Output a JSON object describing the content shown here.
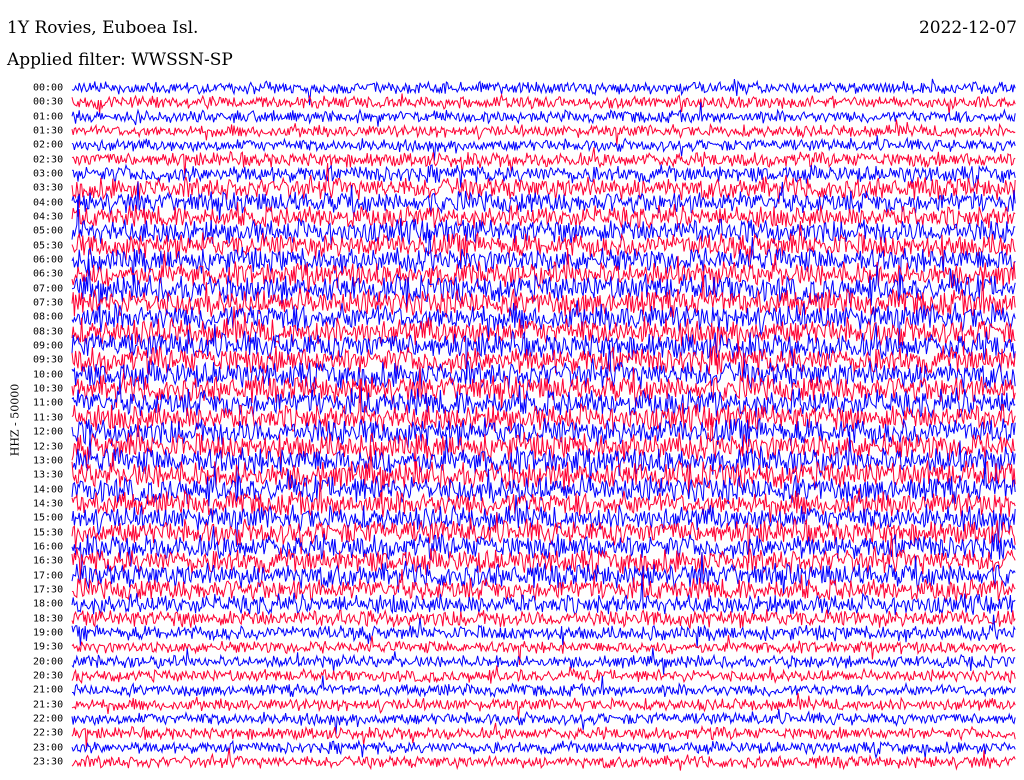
{
  "chart_data": {
    "type": "line",
    "title": "1Y Rovies, Euboea Isl.",
    "date": "2022-12-07",
    "filter_label": "Applied filter: WWSSN-SP",
    "ylabel": "HHZ - 50000",
    "row_labels": [
      "00:00",
      "00:30",
      "01:00",
      "01:30",
      "02:00",
      "02:30",
      "03:00",
      "03:30",
      "04:00",
      "04:30",
      "05:00",
      "05:30",
      "06:00",
      "06:30",
      "07:00",
      "07:30",
      "08:00",
      "08:30",
      "09:00",
      "09:30",
      "10:00",
      "10:30",
      "11:00",
      "11:30",
      "12:00",
      "12:30",
      "13:00",
      "13:30",
      "14:00",
      "14:30",
      "15:00",
      "15:30",
      "16:00",
      "16:30",
      "17:00",
      "17:30",
      "18:00",
      "18:30",
      "19:00",
      "19:30",
      "20:00",
      "20:30",
      "21:00",
      "21:30",
      "22:00",
      "22:30",
      "23:00",
      "23:30"
    ],
    "row_amplitude": [
      5,
      5,
      5,
      5,
      5,
      6,
      7,
      9,
      9,
      9,
      10,
      10,
      10,
      10,
      11,
      11,
      11,
      11,
      11,
      11,
      11,
      11,
      11,
      11,
      11,
      11,
      11,
      11,
      11,
      10,
      10,
      10,
      10,
      10,
      10,
      9,
      8,
      7,
      6,
      5,
      5,
      5,
      5,
      5,
      5,
      5,
      5,
      5
    ],
    "series_colors": [
      "#0000ff",
      "#ff0033"
    ],
    "grid": false
  }
}
